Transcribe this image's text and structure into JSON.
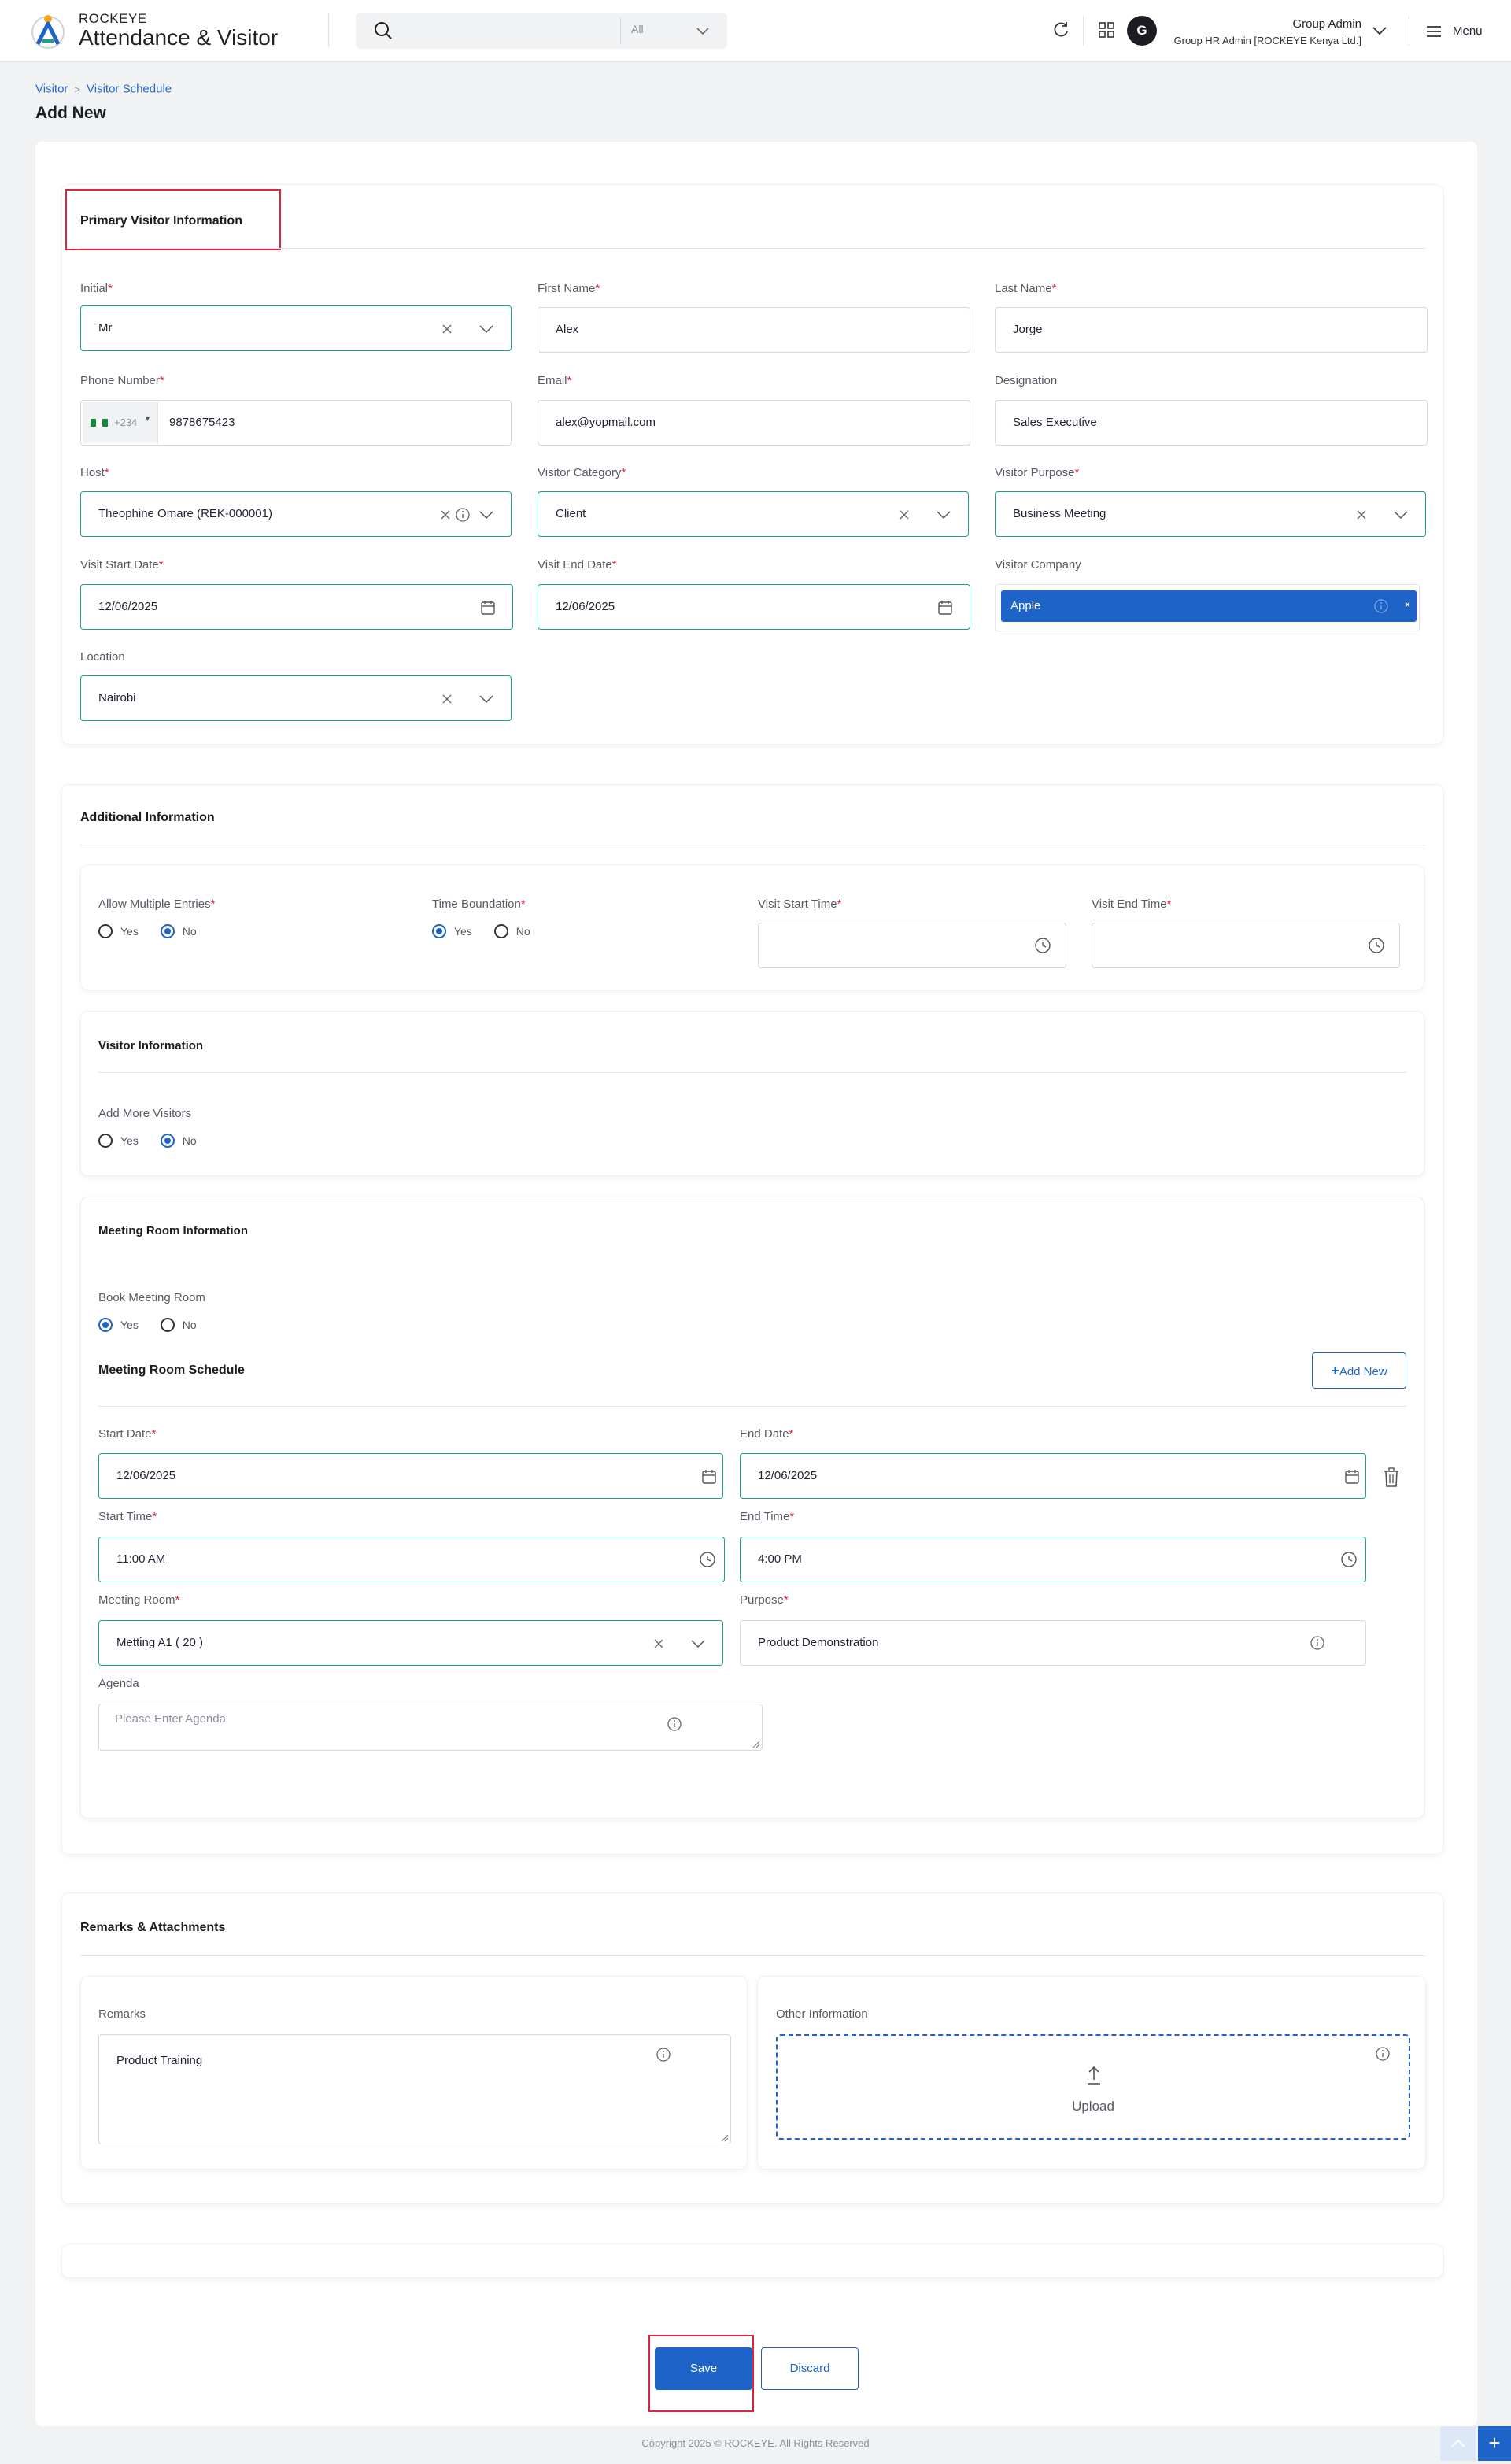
{
  "header": {
    "brand_small": "ROCKEYE",
    "brand_big": "Attendance & Visitor",
    "search_scope": "All",
    "avatar_initial": "G",
    "user_name": "Group Admin",
    "user_org": "Group HR Admin [ROCKEYE Kenya Ltd.]",
    "menu_label": "Menu"
  },
  "breadcrumb": {
    "root": "Visitor",
    "current": "Visitor Schedule"
  },
  "page_title": "Add New",
  "primary": {
    "title": "Primary Visitor Information",
    "initial_label": "Initial",
    "initial_value": "Mr",
    "first_name_label": "First Name",
    "first_name_value": "Alex",
    "last_name_label": "Last Name",
    "last_name_value": "Jorge",
    "phone_label": "Phone Number",
    "phone_code": "+234",
    "phone_value": "9878675423",
    "email_label": "Email",
    "email_value": "alex@yopmail.com",
    "designation_label": "Designation",
    "designation_value": "Sales Executive",
    "host_label": "Host",
    "host_value": "Theophine Omare (REK-000001)",
    "category_label": "Visitor Category",
    "category_value": "Client",
    "purpose_label": "Visitor Purpose",
    "purpose_value": "Business Meeting",
    "start_date_label": "Visit Start Date",
    "start_date_value": "12/06/2025",
    "end_date_label": "Visit End Date",
    "end_date_value": "12/06/2025",
    "company_label": "Visitor Company",
    "company_value": "Apple",
    "location_label": "Location",
    "location_value": "Nairobi"
  },
  "additional": {
    "title": "Additional Information",
    "multiple_entries_label": "Allow Multiple Entries",
    "time_boundation_label": "Time Boundation",
    "visit_start_time_label": "Visit Start Time",
    "visit_end_time_label": "Visit End Time",
    "yes": "Yes",
    "no": "No"
  },
  "visitor_info": {
    "title": "Visitor Information",
    "add_more_label": "Add More Visitors"
  },
  "meeting": {
    "title": "Meeting Room Information",
    "book_label": "Book Meeting Room",
    "schedule_title": "Meeting Room Schedule",
    "add_new": "Add New",
    "start_date_label": "Start Date",
    "start_date_value": "12/06/2025",
    "end_date_label": "End Date",
    "end_date_value": "12/06/2025",
    "start_time_label": "Start Time",
    "start_time_value": "11:00 AM",
    "end_time_label": "End Time",
    "end_time_value": "4:00 PM",
    "room_label": "Meeting Room",
    "room_value": "Metting A1 ( 20 )",
    "purpose_label": "Purpose",
    "purpose_value": "Product Demonstration",
    "agenda_label": "Agenda",
    "agenda_placeholder": "Please Enter Agenda"
  },
  "remarks": {
    "title": "Remarks & Attachments",
    "remarks_label": "Remarks",
    "remarks_value": "Product Training",
    "other_label": "Other Information",
    "upload_label": "Upload"
  },
  "actions": {
    "save": "Save",
    "discard": "Discard"
  },
  "footer": "Copyright 2025 © ROCKEYE. All Rights Reserved",
  "colors": {
    "accent": "#1e63c8",
    "field_valid": "#18a38c",
    "required": "#e0253a",
    "highlight": "#e0253a"
  }
}
